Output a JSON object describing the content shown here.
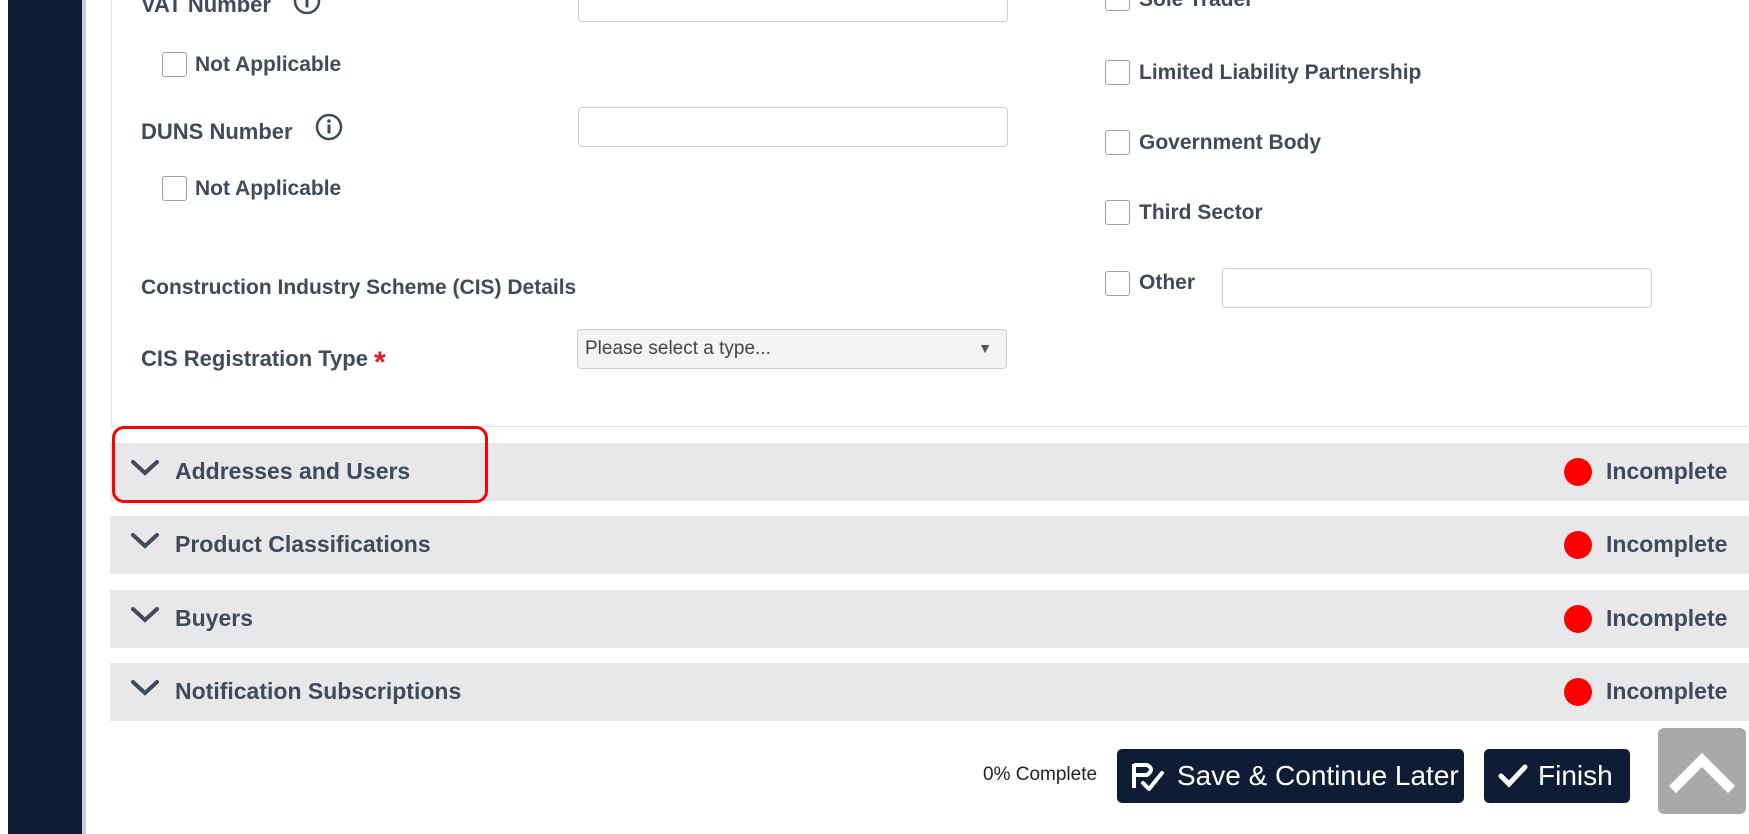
{
  "form": {
    "vat_label": "VAT Number",
    "vat_not_applicable": "Not Applicable",
    "duns_label": "DUNS Number",
    "duns_not_applicable": "Not Applicable",
    "cis_heading": "Construction Industry Scheme (CIS) Details",
    "cis_type_label": "CIS Registration Type",
    "cis_required_marker": "*",
    "cis_type_placeholder": "Please select a type...",
    "org_types": {
      "sole_trader": "Sole Trader",
      "llp": "Limited Liability Partnership",
      "government": "Government Body",
      "third_sector": "Third Sector",
      "other": "Other"
    }
  },
  "sections": [
    {
      "title": "Addresses and Users",
      "status": "Incomplete"
    },
    {
      "title": "Product Classifications",
      "status": "Incomplete"
    },
    {
      "title": "Buyers",
      "status": "Incomplete"
    },
    {
      "title": "Notification Subscriptions",
      "status": "Incomplete"
    }
  ],
  "footer": {
    "progress_text": "0% Complete",
    "save_label": "Save & Continue Later",
    "finish_label": "Finish"
  },
  "colors": {
    "navy": "#0f1c36",
    "status_red": "#ff0000",
    "highlight": "#ff0000"
  },
  "icons": {
    "info": "info-icon",
    "chevron": "chevron-down-icon",
    "save": "save-continue-icon",
    "check": "check-icon",
    "scroll_top": "chevron-up-icon"
  }
}
